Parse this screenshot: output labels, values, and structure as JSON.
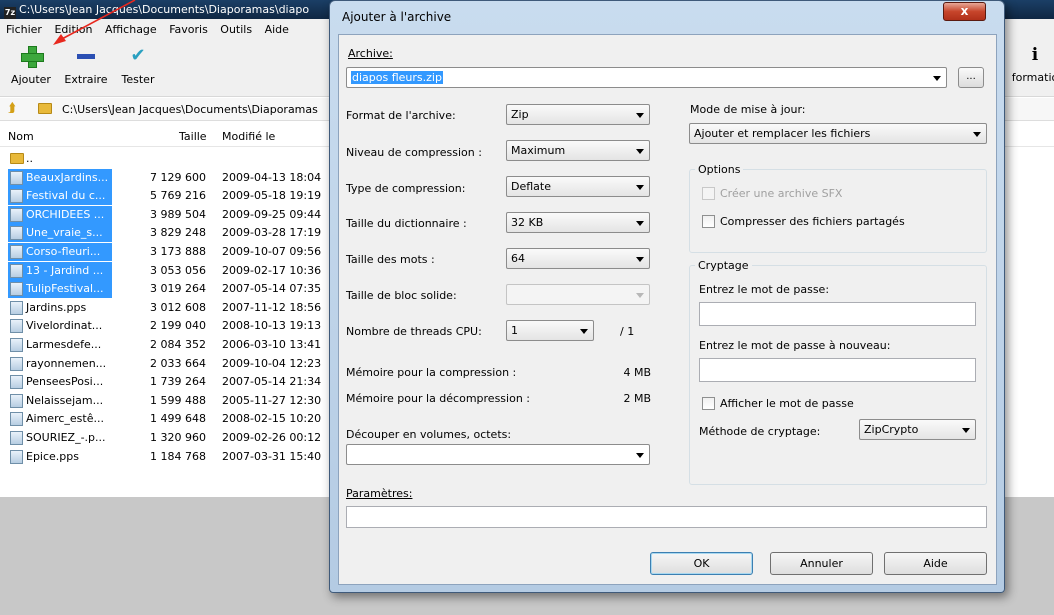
{
  "bg_window": {
    "title": "C:\\Users\\Jean Jacques\\Documents\\Diaporamas\\diapo",
    "menu": [
      "Fichier",
      "Edition",
      "Affichage",
      "Favoris",
      "Outils",
      "Aide"
    ],
    "toolbar": {
      "add": "Ajouter",
      "extract": "Extraire",
      "test": "Tester",
      "info": "formatio"
    },
    "address": "C:\\Users\\Jean Jacques\\Documents\\Diaporamas",
    "columns": {
      "name": "Nom",
      "size": "Taille",
      "modified": "Modifié le"
    },
    "parent": "..",
    "files": [
      {
        "name": "BeauxJardins...",
        "size": "7 129 600",
        "date": "2009-04-13 18:04",
        "selected": true
      },
      {
        "name": "Festival du c...",
        "size": "5 769 216",
        "date": "2009-05-18 19:19",
        "selected": true
      },
      {
        "name": "ORCHIDEES ...",
        "size": "3 989 504",
        "date": "2009-09-25 09:44",
        "selected": true
      },
      {
        "name": "Une_vraie_s...",
        "size": "3 829 248",
        "date": "2009-03-28 17:19",
        "selected": true
      },
      {
        "name": "Corso-fleuri...",
        "size": "3 173 888",
        "date": "2009-10-07 09:56",
        "selected": true
      },
      {
        "name": "13 - Jardind ...",
        "size": "3 053 056",
        "date": "2009-02-17 10:36",
        "selected": true
      },
      {
        "name": "TulipFestival...",
        "size": "3 019 264",
        "date": "2007-05-14 07:35",
        "selected": true
      },
      {
        "name": "Jardins.pps",
        "size": "3 012 608",
        "date": "2007-11-12 18:56",
        "selected": false
      },
      {
        "name": "Vivelordinat...",
        "size": "2 199 040",
        "date": "2008-10-13 19:13",
        "selected": false
      },
      {
        "name": "Larmesdefe...",
        "size": "2 084 352",
        "date": "2006-03-10 13:41",
        "selected": false
      },
      {
        "name": "rayonnemen...",
        "size": "2 033 664",
        "date": "2009-10-04 12:23",
        "selected": false
      },
      {
        "name": "PenseesPosi...",
        "size": "1 739 264",
        "date": "2007-05-14 21:34",
        "selected": false
      },
      {
        "name": "Nelaissejam...",
        "size": "1 599 488",
        "date": "2005-11-27 12:30",
        "selected": false
      },
      {
        "name": "Aimerc_estê...",
        "size": "1 499 648",
        "date": "2008-02-15 10:20",
        "selected": false
      },
      {
        "name": "SOURIEZ_-.p...",
        "size": "1 320 960",
        "date": "2009-02-26 00:12",
        "selected": false
      },
      {
        "name": "Epice.pps",
        "size": "1 184 768",
        "date": "2007-03-31 15:40",
        "selected": false
      }
    ]
  },
  "dialog": {
    "title": "Ajouter à l'archive",
    "close": "x",
    "archive_label": "Archive:",
    "archive_value": "diapos fleurs.zip",
    "browse": "...",
    "format_label": "Format de l'archive:",
    "format_value": "Zip",
    "level_label": "Niveau de compression :",
    "level_value": "Maximum",
    "method_label": "Type de compression:",
    "method_value": "Deflate",
    "dict_label": "Taille du dictionnaire :",
    "dict_value": "32 KB",
    "word_label": "Taille des mots :",
    "word_value": "64",
    "solid_label": "Taille de bloc solide:",
    "solid_value": "",
    "threads_label": "Nombre de threads CPU:",
    "threads_value": "1",
    "threads_max": "/ 1",
    "mem_comp_label": "Mémoire pour la compression :",
    "mem_comp_value": "4 MB",
    "mem_decomp_label": "Mémoire pour la décompression :",
    "mem_decomp_value": "2 MB",
    "split_label": "Découper en volumes, octets:",
    "split_value": "",
    "params_label": "Paramètres:",
    "params_value": "",
    "update_label": "Mode de mise à jour:",
    "update_value": "Ajouter et remplacer les fichiers",
    "options_title": "Options",
    "sfx_label": "Créer une archive SFX",
    "shared_label": "Compresser des fichiers partagés",
    "crypt_title": "Cryptage",
    "pwd_label": "Entrez le mot de passe:",
    "pwd2_label": "Entrez le mot de passe à nouveau:",
    "show_pwd_label": "Afficher le mot de passe",
    "crypt_method_label": "Méthode de cryptage:",
    "crypt_method_value": "ZipCrypto",
    "ok": "OK",
    "cancel": "Annuler",
    "help": "Aide"
  },
  "annotation_color": "#e8281e"
}
